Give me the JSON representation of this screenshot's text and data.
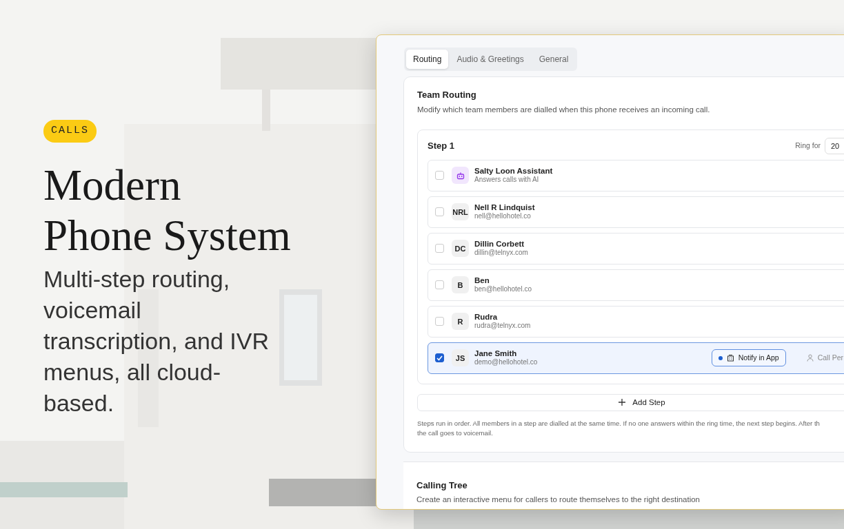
{
  "hero": {
    "badge": "CALLS",
    "headline_lines": [
      "Modern",
      "Phone System"
    ],
    "subtitle_lines": [
      "Multi-step routing,",
      "voicemail",
      "transcription, and IVR",
      "menus, all cloud-",
      "based."
    ]
  },
  "tabs": [
    {
      "label": "Routing",
      "selected": true
    },
    {
      "label": "Audio & Greetings",
      "selected": false
    },
    {
      "label": "General",
      "selected": false
    }
  ],
  "team_routing": {
    "title": "Team Routing",
    "description": "Modify which team members are dialled when this phone receives an incoming call.",
    "step": {
      "title": "Step 1",
      "ring_label": "Ring for",
      "ring_value": "20",
      "members": [
        {
          "kind": "assistant",
          "name": "Salty Loon Assistant",
          "detail": "Answers calls with AI",
          "checked": false
        },
        {
          "kind": "person",
          "initials": "NRL",
          "name": "Nell R Lindquist",
          "detail": "nell@hellohotel.co",
          "checked": false
        },
        {
          "kind": "person",
          "initials": "DC",
          "name": "Dillin Corbett",
          "detail": "dillin@telnyx.com",
          "checked": false
        },
        {
          "kind": "person",
          "initials": "B",
          "name": "Ben",
          "detail": "ben@hellohotel.co",
          "checked": false
        },
        {
          "kind": "person",
          "initials": "R",
          "name": "Rudra",
          "detail": "rudra@telnyx.com",
          "checked": false
        },
        {
          "kind": "person",
          "initials": "JS",
          "name": "Jane Smith",
          "detail": "demo@hellohotel.co",
          "checked": true,
          "notify": "Notify in App",
          "call": "Call Per"
        }
      ]
    },
    "add_step": "Add Step",
    "note_lines": [
      "Steps run in order. All members in a step are dialled at the same time. If no one answers within the ring time, the next step begins. After th",
      "the call goes to voicemail."
    ]
  },
  "calling_tree": {
    "title": "Calling Tree",
    "description": "Create an interactive menu for callers to route themselves to the right destination"
  }
}
